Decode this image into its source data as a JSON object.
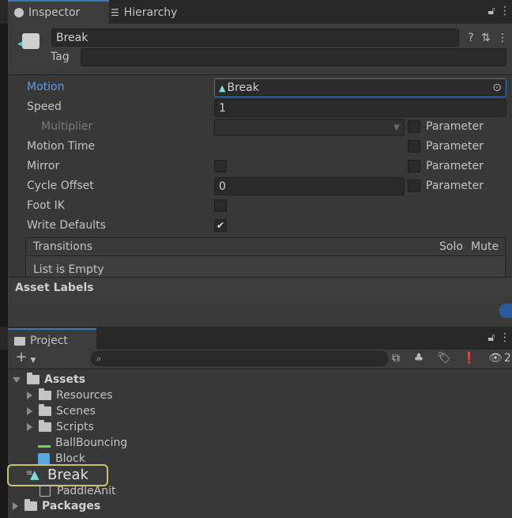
{
  "tabs": {
    "inspector": "Inspector",
    "hierarchy": "Hierarchy",
    "project": "Project"
  },
  "header": {
    "name": "Break",
    "tag_label": "Tag",
    "tag_value": ""
  },
  "fields": {
    "motion_label": "Motion",
    "motion_value": "Break",
    "speed_label": "Speed",
    "speed_value": "1",
    "multiplier_label": "Multiplier",
    "motion_time_label": "Motion Time",
    "mirror_label": "Mirror",
    "cycle_offset_label": "Cycle Offset",
    "cycle_offset_value": "0",
    "foot_ik_label": "Foot IK",
    "write_defaults_label": "Write Defaults",
    "parameter_label": "Parameter"
  },
  "toggles": {
    "multiplier_param": false,
    "motion_time_param": false,
    "mirror": false,
    "mirror_param": false,
    "cycle_offset_param": false,
    "foot_ik": false,
    "write_defaults": true
  },
  "transitions": {
    "title": "Transitions",
    "solo": "Solo",
    "mute": "Mute",
    "empty": "List is Empty"
  },
  "asset_labels": "Asset Labels",
  "project": {
    "search_placeholder": "",
    "hidden_count": "2",
    "tree": {
      "assets": "Assets",
      "resources": "Resources",
      "scenes": "Scenes",
      "scripts": "Scripts",
      "ball_bouncing": "BallBouncing",
      "block": "Block",
      "break": "Break",
      "paddle_anit": "PaddleAnit",
      "packages": "Packages"
    }
  },
  "colors": {
    "accent": "#3a79bb",
    "motion_label": "#5d9ce0",
    "highlight": "#c8c36a",
    "anim_icon": "#7ee0d6"
  }
}
